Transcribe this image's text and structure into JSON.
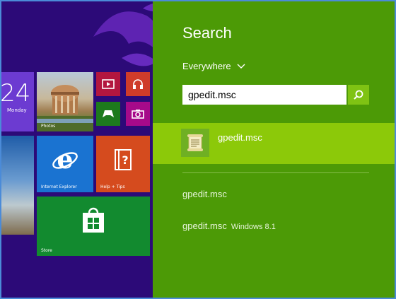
{
  "start_screen": {
    "date_tile": {
      "number": "24",
      "day": "Monday"
    },
    "tiles": {
      "photos": "Photos",
      "internet_explorer": "Internet Explorer",
      "help_tips": "Help + Tips",
      "store": "Store"
    },
    "colors": {
      "background": "#2c0a78",
      "ie": "#1a73d1",
      "help": "#d54b1e",
      "store": "#128a2f"
    }
  },
  "search_pane": {
    "title": "Search",
    "scope": "Everywhere",
    "query": "gpedit.msc",
    "top_result": "gpedit.msc",
    "suggestions": [
      {
        "text": "gpedit.msc",
        "hint": ""
      },
      {
        "text": "gpedit.msc",
        "hint": "Windows 8.1"
      }
    ],
    "colors": {
      "pane": "#4c9a06",
      "highlight": "#8cc909",
      "search_button": "#7fc313"
    }
  }
}
